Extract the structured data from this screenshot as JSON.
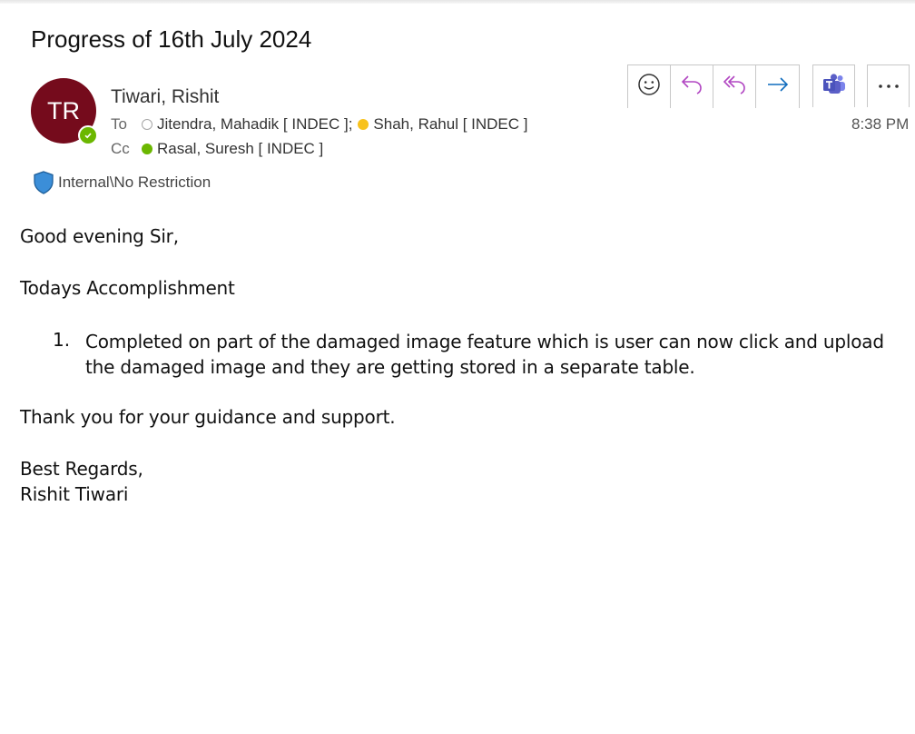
{
  "email": {
    "subject": "Progress of 16th July 2024",
    "sender": {
      "initials": "TR",
      "name": "Tiwari, Rishit",
      "avatar_color": "#750b1c",
      "presence": "available"
    },
    "to_label": "To",
    "cc_label": "Cc",
    "to": [
      {
        "name": "Jitendra, Mahadik [ INDEC ];",
        "presence": "offline"
      },
      {
        "name": "Shah, Rahul [ INDEC ]",
        "presence": "away"
      }
    ],
    "cc": [
      {
        "name": "Rasal, Suresh [ INDEC ]",
        "presence": "available"
      }
    ],
    "time": "8:38 PM",
    "sensitivity_label": "Internal\\No Restriction",
    "body": {
      "greeting": "Good evening Sir,",
      "section_heading": "Todays Accomplishment",
      "list_items": [
        {
          "number": "1.",
          "text": "Completed on part of the damaged image feature which is user can now click and upload the damaged image and they are getting stored in a separate table."
        }
      ],
      "thanks": "Thank you for your guidance and support.",
      "closing": "Best Regards,",
      "signature": "Rishit Tiwari"
    }
  },
  "toolbar": {
    "icons": [
      "emoji-icon",
      "reply-icon",
      "reply-all-icon",
      "forward-icon",
      "teams-icon",
      "more-icon"
    ],
    "reply_color": "#b146c2",
    "forward_color": "#0f6cbd",
    "teams_color": "#5b5fc7"
  }
}
